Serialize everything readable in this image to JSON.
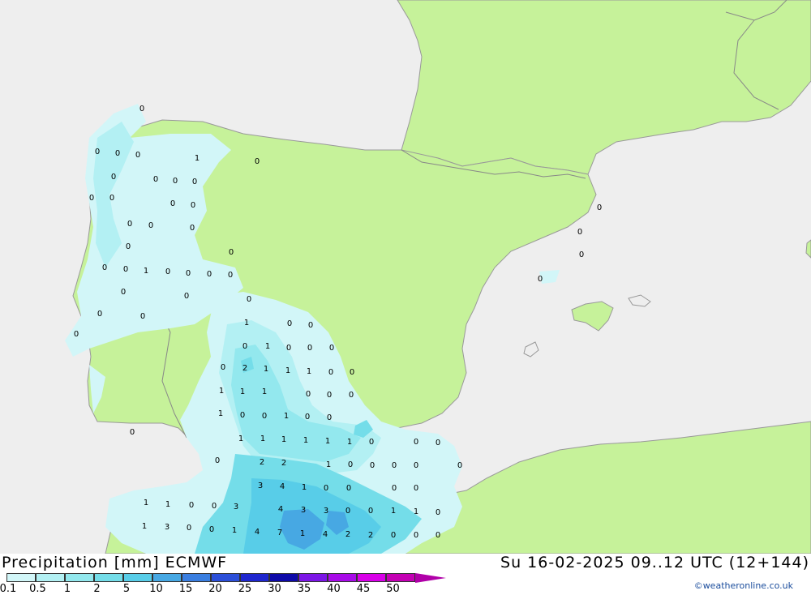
{
  "title": "Precipitation [mm] ECMWF",
  "datetime": "Su 16-02-2025 09..12 UTC (12+144)",
  "credit": "©weatheronline.co.uk",
  "colors": {
    "sea": "#eeeeee",
    "land": "#c6f29a",
    "border": "#888888",
    "coast": "#999999"
  },
  "legend": {
    "labels": [
      "0.1",
      "0.5",
      "1",
      "2",
      "5",
      "10",
      "15",
      "20",
      "25",
      "30",
      "35",
      "40",
      "45",
      "50"
    ],
    "colors": [
      "#d2f6f8",
      "#b3f0f3",
      "#93e8ee",
      "#74dde9",
      "#58cde8",
      "#47a8e3",
      "#3a7ee0",
      "#2c4fd8",
      "#1f27cf",
      "#0e0aa8",
      "#7c16e6",
      "#a80be8",
      "#d800e8",
      "#c400b4"
    ]
  },
  "point_values": [
    "0",
    "0",
    "0",
    "0",
    "1",
    "0",
    "0",
    "0",
    "0",
    "0",
    "0",
    "0",
    "0",
    "0",
    "0",
    "0",
    "0",
    "0",
    "0",
    "0",
    "0",
    "1",
    "0",
    "0",
    "0",
    "0",
    "0",
    "0",
    "0",
    "0",
    "0",
    "0",
    "0",
    "1",
    "0",
    "0",
    "0",
    "1",
    "0",
    "0",
    "0",
    "2",
    "1",
    "1",
    "1",
    "0",
    "0",
    "0",
    "1",
    "1",
    "1",
    "0",
    "0",
    "0",
    "1",
    "0",
    "0",
    "1",
    "0",
    "0",
    "1",
    "1",
    "1",
    "1",
    "1",
    "1",
    "0",
    "0",
    "0",
    "2",
    "2",
    "1",
    "0",
    "0",
    "0",
    "0",
    "0",
    "3",
    "4",
    "1",
    "0",
    "0",
    "0",
    "0",
    "1",
    "1",
    "0",
    "0",
    "3",
    "4",
    "3",
    "3",
    "0",
    "0",
    "1",
    "1",
    "0",
    "1",
    "3",
    "0",
    "0",
    "1",
    "4",
    "7",
    "1",
    "4",
    "2",
    "2",
    "0",
    "0",
    "0",
    "0",
    "0",
    "0",
    "0",
    "0"
  ]
}
